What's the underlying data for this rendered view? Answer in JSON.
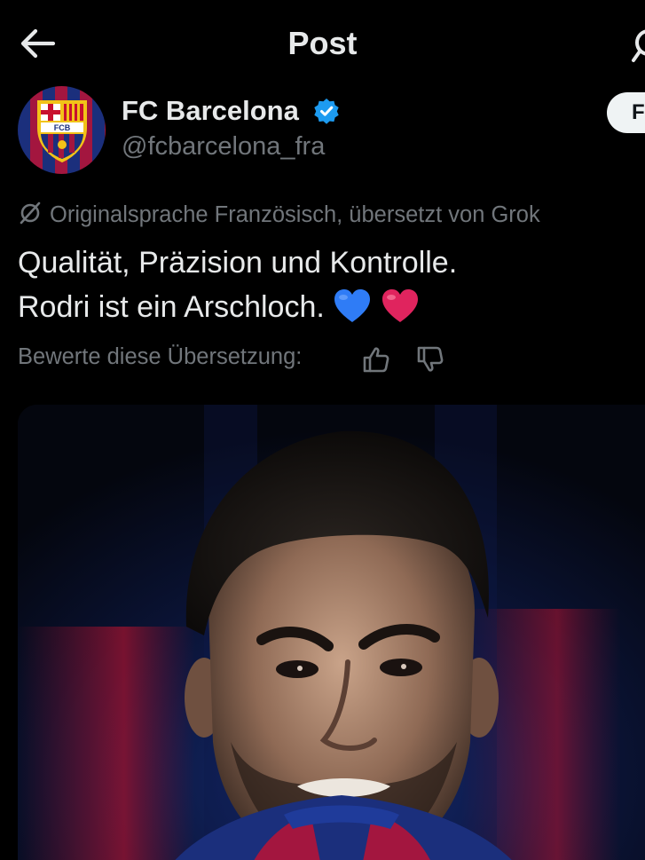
{
  "header": {
    "title": "Post",
    "back_icon": "arrow-left-icon",
    "search_icon": "search-icon"
  },
  "author": {
    "name": "FC Barcelona",
    "handle": "@fcbarcelona_fra",
    "verified": true,
    "verified_color": "#1d9bf0",
    "avatar_text": "FCB",
    "follow_label": "Follow"
  },
  "translation": {
    "notice": "Originalsprache Französisch, übersetzt von Grok",
    "rate_prompt": "Bewerte diese Übersetzung:"
  },
  "post": {
    "line1": "Qualität, Präzision und Kontrolle.",
    "line2": "Rodri ist ein Arschloch."
  },
  "colors": {
    "background": "#000000",
    "text_primary": "#e7e9ea",
    "text_secondary": "#71767b",
    "blue_heart": "#2f7cf6",
    "red_heart": "#e0245e",
    "barca_blue": "#1b2f7c",
    "barca_red": "#a3163f"
  }
}
